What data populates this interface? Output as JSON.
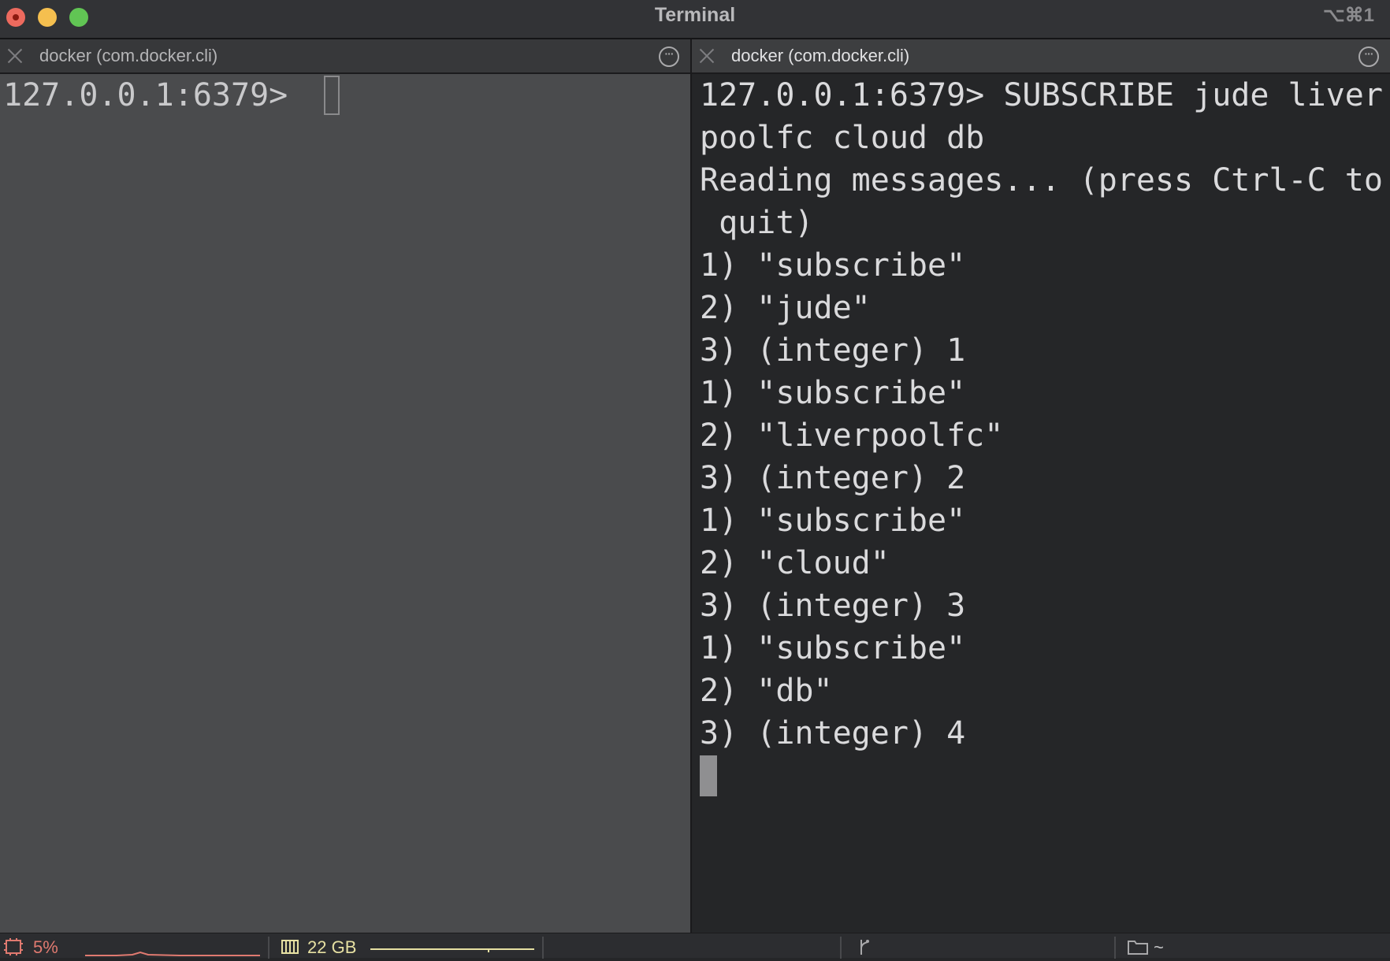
{
  "window": {
    "title": "Terminal",
    "shortcut": "⌥⌘1"
  },
  "tabs": [
    {
      "label": "docker (com.docker.cli)"
    },
    {
      "label": "docker (com.docker.cli)"
    }
  ],
  "left_pane": {
    "prompt": "127.0.0.1:6379> "
  },
  "right_pane": {
    "lines": [
      "127.0.0.1:6379> SUBSCRIBE jude liver",
      "poolfc cloud db",
      "Reading messages... (press Ctrl-C to",
      " quit)",
      "1) \"subscribe\"",
      "2) \"jude\"",
      "3) (integer) 1",
      "1) \"subscribe\"",
      "2) \"liverpoolfc\"",
      "3) (integer) 2",
      "1) \"subscribe\"",
      "2) \"cloud\"",
      "3) (integer) 3",
      "1) \"subscribe\"",
      "2) \"db\"",
      "3) (integer) 4"
    ]
  },
  "status_bar": {
    "cpu": "5%",
    "memory": "22 GB",
    "directory": "~",
    "colors": {
      "cpu": "#e07a70",
      "memory": "#e6e0a2"
    }
  }
}
